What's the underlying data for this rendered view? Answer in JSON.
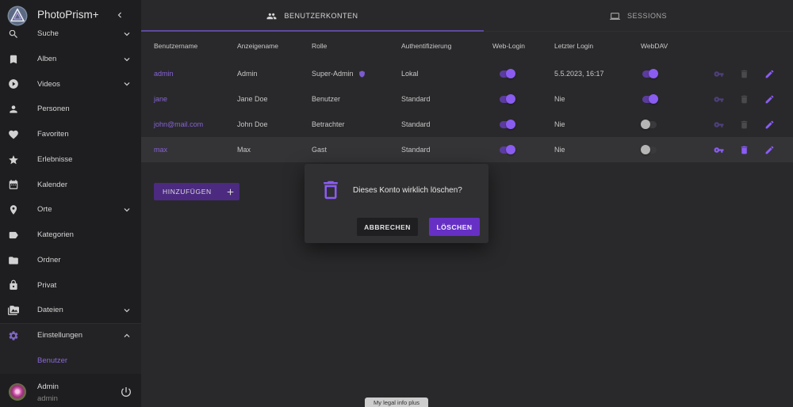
{
  "app": {
    "title": "PhotoPrism+",
    "logo_icon": "photoprism-logo-icon",
    "collapse_icon": "chevron-left-icon"
  },
  "theme": {
    "accent": "#8b5cf6",
    "sidebar_bg": "#1e1e20",
    "main_bg": "#29292b",
    "danger_button": "#6630c4"
  },
  "sidebar": {
    "items": [
      {
        "label": "Suche",
        "icon": "search-icon",
        "expandable": true
      },
      {
        "label": "Alben",
        "icon": "bookmark-icon",
        "expandable": true
      },
      {
        "label": "Videos",
        "icon": "play-circle-icon",
        "expandable": true
      },
      {
        "label": "Personen",
        "icon": "person-icon",
        "expandable": false
      },
      {
        "label": "Favoriten",
        "icon": "heart-icon",
        "expandable": false
      },
      {
        "label": "Erlebnisse",
        "icon": "star-icon",
        "expandable": false
      },
      {
        "label": "Kalender",
        "icon": "calendar-icon",
        "expandable": false
      },
      {
        "label": "Orte",
        "icon": "place-icon",
        "expandable": true
      },
      {
        "label": "Kategorien",
        "icon": "label-icon",
        "expandable": false
      },
      {
        "label": "Ordner",
        "icon": "folder-icon",
        "expandable": false
      },
      {
        "label": "Privat",
        "icon": "lock-icon",
        "expandable": false
      },
      {
        "label": "Dateien",
        "icon": "media-folder-icon",
        "expandable": true
      }
    ],
    "settings": {
      "label": "Einstellungen",
      "icon": "gear-icon",
      "expanded": true,
      "subitems": [
        {
          "label": "Benutzer",
          "active": true
        }
      ]
    },
    "user": {
      "name": "Admin",
      "username": "admin",
      "logout_icon": "power-icon"
    }
  },
  "tabs": [
    {
      "label": "BENUTZERKONTEN",
      "icon": "people-icon",
      "active": true
    },
    {
      "label": "SESSIONS",
      "icon": "laptop-icon",
      "active": false
    }
  ],
  "table": {
    "headers": {
      "username": "Benutzername",
      "display_name": "Anzeigename",
      "role": "Rolle",
      "auth": "Authentifizierung",
      "web_login": "Web-Login",
      "last_login": "Letzter Login",
      "webdav": "WebDAV"
    },
    "rows": [
      {
        "username": "admin",
        "display_name": "Admin",
        "role": "Super-Admin",
        "role_icon": "shield-icon",
        "auth": "Lokal",
        "web_login": true,
        "last_login": "5.5.2023, 16:17",
        "webdav": true,
        "hovered": false
      },
      {
        "username": "jane",
        "display_name": "Jane Doe",
        "role": "Benutzer",
        "auth": "Standard",
        "web_login": true,
        "last_login": "Nie",
        "webdav": true,
        "hovered": false
      },
      {
        "username": "john@mail.com",
        "display_name": "John Doe",
        "role": "Betrachter",
        "auth": "Standard",
        "web_login": true,
        "last_login": "Nie",
        "webdav": false,
        "hovered": false
      },
      {
        "username": "max",
        "display_name": "Max",
        "role": "Gast",
        "auth": "Standard",
        "web_login": true,
        "last_login": "Nie",
        "webdav": false,
        "hovered": true
      }
    ],
    "row_actions": [
      "key-icon",
      "trash-icon",
      "pencil-icon"
    ]
  },
  "add_button": {
    "label": "HINZUFÜGEN",
    "icon": "plus-icon"
  },
  "dialog": {
    "icon": "trash-outline-icon",
    "message": "Dieses Konto wirklich löschen?",
    "cancel_label": "ABBRECHEN",
    "confirm_label": "LÖSCHEN"
  },
  "footer": {
    "legal_label": "My legal info plus"
  }
}
